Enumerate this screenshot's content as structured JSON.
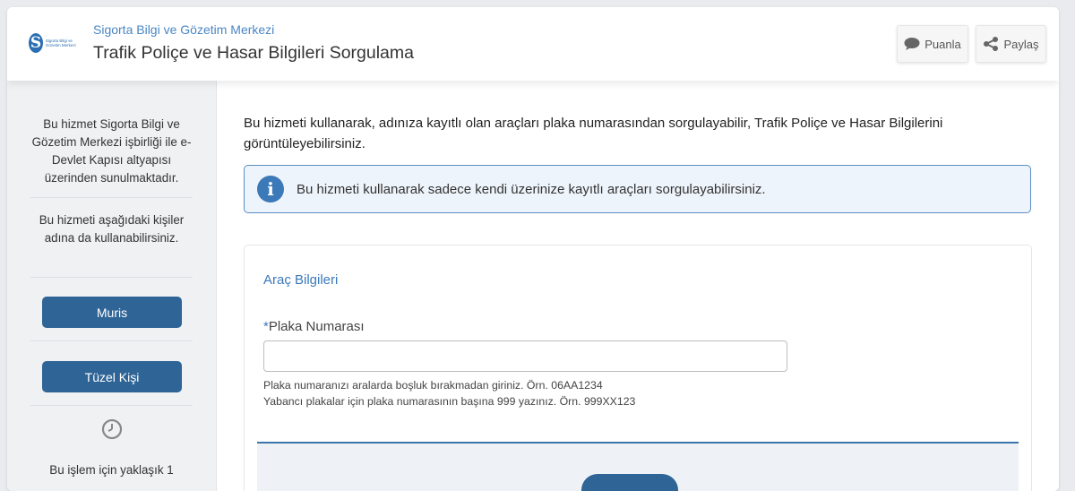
{
  "header": {
    "org_name": "Sigorta Bilgi ve Gözetim Merkezi",
    "page_title": "Trafik Poliçe ve Hasar Bilgileri Sorgulama",
    "logo_text": "Sigorta Bilgi ve Gözetim Merkezi",
    "rate_label": "Puanla",
    "share_label": "Paylaş"
  },
  "sidebar": {
    "description": "Bu hizmet Sigorta Bilgi ve Gözetim Merkezi işbirliği ile e-Devlet Kapısı altyapısı üzerinden sunulmaktadır.",
    "on_behalf_text": "Bu hizmeti aşağıdaki kişiler adına da kullanabilirsiniz.",
    "buttons": [
      {
        "label": "Muris"
      },
      {
        "label": "Tüzel Kişi"
      }
    ],
    "duration_text": "Bu işlem için yaklaşık 1"
  },
  "main": {
    "intro": "Bu hizmeti kullanarak, adınıza kayıtlı olan araçları plaka numarasından sorgulayabilir, Trafik Poliçe ve Hasar Bilgilerini görüntüleyebilirsiniz.",
    "info_text": "Bu hizmeti kullanarak sadece kendi üzerinize kayıtlı araçları sorgulayabilirsiniz.",
    "form": {
      "section_title": "Araç Bilgileri",
      "plate_label_required": "*",
      "plate_label": "Plaka Numarası",
      "plate_value": "",
      "hint1": "Plaka numaranızı aralarda boşluk bırakmadan giriniz. Örn. 06AA1234",
      "hint2": "Yabancı plakalar için plaka numarasının başına 999 yazınız. Örn. 999XX123"
    }
  },
  "colors": {
    "accent": "#2f6496",
    "link": "#3b79b9",
    "sidebar_bg": "#f0f1f3",
    "info_bg": "#eef4fb"
  }
}
